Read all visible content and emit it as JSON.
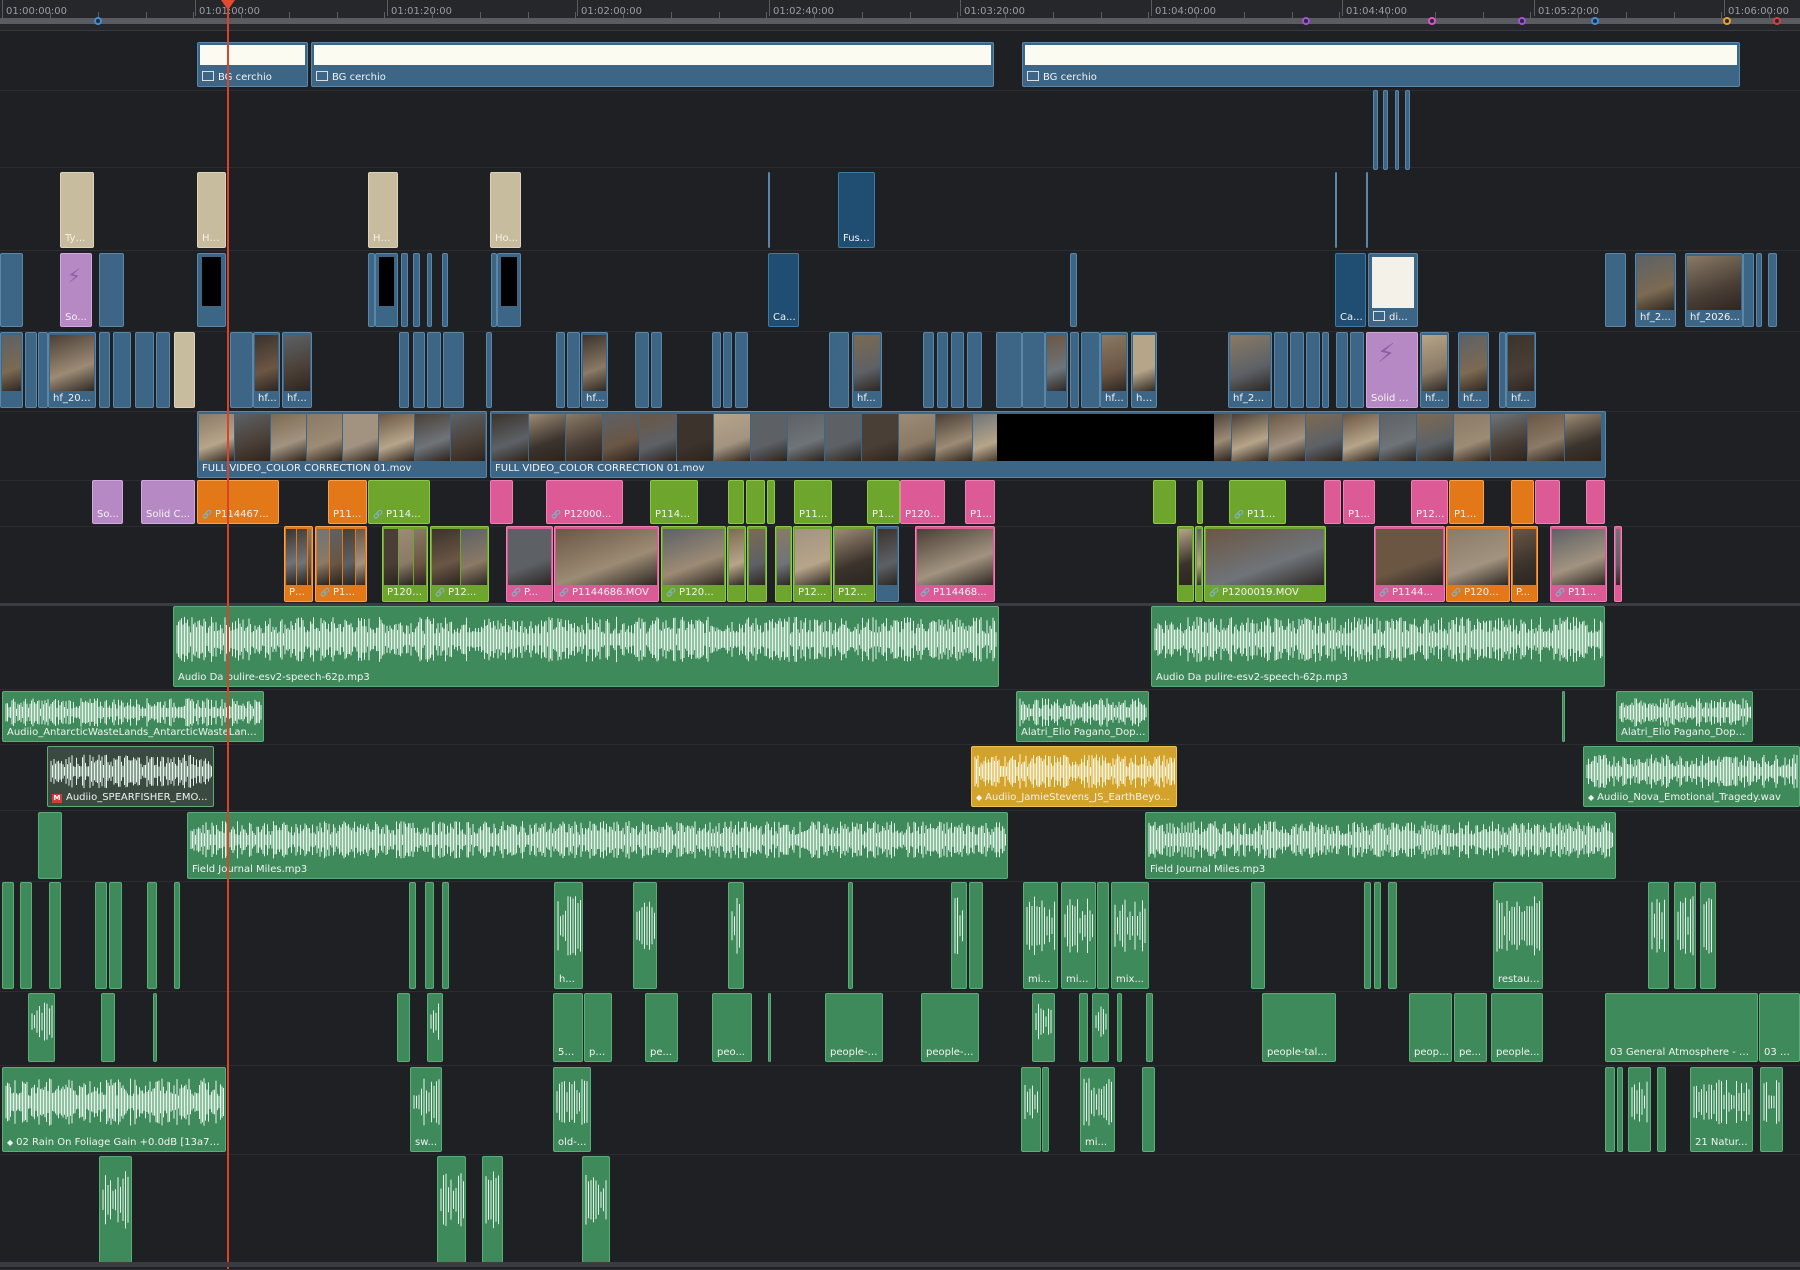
{
  "ruler": {
    "timecodes": [
      "01:00:00:00",
      "01:01:00:00",
      "01:01:20:00",
      "01:02:00:00",
      "01:02:40:00",
      "01:03:20:00",
      "01:04:00:00",
      "01:04:40:00",
      "01:05:20:00",
      "01:06:00:00"
    ],
    "marker_colors": [
      "#3b8fe0",
      "#a64fe0",
      "#e050c8",
      "#a64fe0",
      "#3b8fe0",
      "#e8a323",
      "#e03c3c"
    ]
  },
  "title_clips": [
    "BG cerchio",
    "BG cerchio",
    "BG cerchio"
  ],
  "v_top": [
    "Typ...",
    "Ho...",
    "Ho...",
    "Ho...",
    "Fusi..."
  ],
  "v_row2": [
    "So...",
    "Ca...",
    "Ca...",
    "di...",
    "hf_2...",
    "hf_2026..."
  ],
  "v_row3": [
    "hf_202...",
    "hf...",
    "hf_...",
    "hf...",
    "hf...",
    "hf...",
    "hf...",
    "hf_20...",
    "Solid C...",
    "hf...",
    "hf...",
    "hf..."
  ],
  "main_clips": [
    "FULL VIDEO_COLOR CORRECTION 01.mov",
    "FULL VIDEO_COLOR CORRECTION 01.mov"
  ],
  "v_row5": [
    "So...",
    "Solid C...",
    "P114467...",
    "P11...",
    "P114...",
    "P12000...",
    "P1144...",
    "P11...",
    "P1...",
    "P120...",
    "P1...",
    "P11...",
    "P1...",
    "P12...",
    "P11..."
  ],
  "v_row6": [
    "P1...",
    "P1...",
    "P1200...",
    "P12...",
    "P...",
    "P1144686.MOV",
    "P120...",
    "P12...",
    "P120...",
    "P114468...",
    "P1200019.MOV",
    "P1144...",
    "P120...",
    "P...",
    "P11..."
  ],
  "audio_a1": [
    "Audio Da pulire-esv2-speech-62p.mp3",
    "Audio Da pulire-esv2-speech-62p.mp3"
  ],
  "audio_a2": [
    "Audiio_AntarcticWasteLands_AntarcticWasteLands_...",
    "Alatri_Elio Pagano_Dopp...",
    "Alatri_Elio Pagano_Doppi..."
  ],
  "audio_a3": [
    "Audiio_SPEARFISHER_EMO...",
    "Audiio_JamieStevens_JS_EarthBeyo...",
    "Audiio_Nova_Emotional_Tragedy.wav"
  ],
  "audio_a4": [
    "Field Journal Miles.mp3",
    "Field Journal Miles.mp3"
  ],
  "audio_a5": [
    "h...",
    "mix...",
    "mix...",
    "mix...",
    "restaur..."
  ],
  "audio_a6": [
    "51 ...",
    "pe...",
    "pe...",
    "peo...",
    "people-t...",
    "people-t...",
    "people-talki...",
    "peopl...",
    "pe...",
    "people...",
    "03 General Atmosphere - Co...",
    "03 Gen..."
  ],
  "audio_a7": [
    "02 Rain On Foliage Gain +0.0dB [13a72...",
    "sw...",
    "old-...",
    "mi...",
    "21 Natur..."
  ],
  "colors": {
    "video_blue": "#3d6585",
    "audio_green": "#3f8a5b",
    "playhead": "#d9432b"
  }
}
